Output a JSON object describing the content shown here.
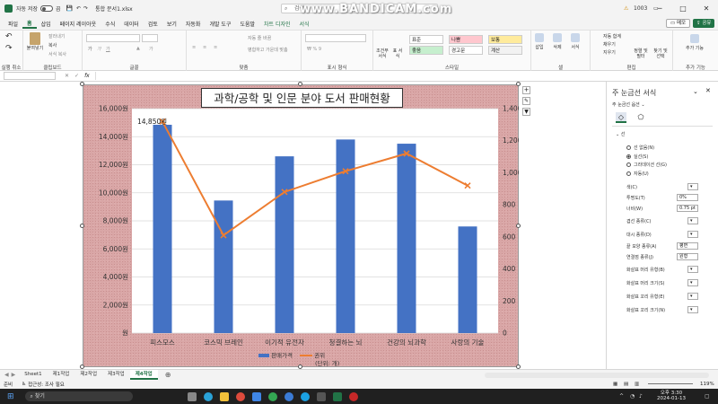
{
  "titlebar": {
    "autosave": "자동 저장",
    "toggle_state": "끔",
    "filename": "통합 문서1.xlsx",
    "search_placeholder": "검색",
    "user_count": "1003"
  },
  "watermark": "www.BANDICAM.com",
  "menu": [
    "파일",
    "홈",
    "삽입",
    "페이지 레이아웃",
    "수식",
    "데이터",
    "검토",
    "보기",
    "자동화",
    "개발 도구",
    "도움말",
    "차트 디자인",
    "서식"
  ],
  "menu_active_index": 1,
  "menu_right": {
    "memo": "메모",
    "share": "공유"
  },
  "ribbon": {
    "groups": [
      "실행 취소",
      "클립보드",
      "글꼴",
      "맞춤",
      "표시 형식",
      "스타일",
      "셀",
      "편집",
      "추가 기능"
    ],
    "paste": "붙여넣기",
    "cut": "잘라내기",
    "copy": "복사",
    "format_painter": "서식 복사",
    "wrap": "자동 줄 바꿈",
    "merge": "병합하고 가운데 맞춤",
    "cond_format": "조건부 서식",
    "table_format": "표 서식",
    "style_normal": "표준",
    "style_bad": "나쁨",
    "style_good": "보통",
    "style_good2": "좋음",
    "style_neutral": "경고문",
    "style_calc": "계산",
    "insert": "삽입",
    "delete": "삭제",
    "format": "서식",
    "autosum": "자동 합계",
    "fill": "채우기",
    "clear": "지우기",
    "sort": "정렬 및 필터",
    "find": "찾기 및 선택",
    "addins": "추가 기능"
  },
  "formula": {
    "fx": "fx",
    "value": ""
  },
  "chart_data": {
    "type": "bar",
    "title": "과학/공학 및 인문 분야 도서 판매현황",
    "categories": [
      "피스모스",
      "코스믹 브레인",
      "이기적 유전자",
      "청결하는 뇌",
      "건강의 뇌과학",
      "사랑의 기술"
    ],
    "series": [
      {
        "name": "판매가격",
        "type": "bar",
        "color": "#4472C4",
        "values": [
          14850,
          9450,
          12600,
          13800,
          13500,
          7600
        ]
      },
      {
        "name": "권위",
        "type": "line",
        "color": "#ED7D31",
        "axis": "secondary",
        "values": [
          1320,
          610,
          880,
          1010,
          1120,
          920
        ]
      }
    ],
    "y_ticks": [
      "원",
      "2,000원",
      "4,000원",
      "6,000원",
      "8,000원",
      "10,000원",
      "12,000원",
      "14,000원",
      "16,000원"
    ],
    "y2_ticks": [
      "0",
      "200",
      "400",
      "600",
      "800",
      "1,000",
      "1,200",
      "1,400"
    ],
    "ylim": [
      0,
      16000
    ],
    "y2lim": [
      0,
      1400
    ],
    "data_label": "14,850원",
    "legend_note": "(단위: 개)",
    "legend_position": "bottom",
    "grid": true
  },
  "pane": {
    "title": "주 눈금선 서식",
    "subtitle": "주 눈금선 옵션",
    "section": "선",
    "options": [
      "선 없음(N)",
      "실선(S)",
      "그라데이션 선(G)",
      "자동(U)"
    ],
    "selected_option": 1,
    "props": [
      {
        "label": "색(C)",
        "value": ""
      },
      {
        "label": "투명도(T)",
        "value": "0%"
      },
      {
        "label": "너비(W)",
        "value": "0.75 pt"
      },
      {
        "label": "겹선 종류(C)",
        "value": ""
      },
      {
        "label": "대시 종류(D)",
        "value": ""
      },
      {
        "label": "끝 모양 종류(A)",
        "value": "평면"
      },
      {
        "label": "연결점 종류(J)",
        "value": "원형"
      },
      {
        "label": "화살표 머리 유형(B)",
        "value": ""
      },
      {
        "label": "화살표 머리 크기(S)",
        "value": ""
      },
      {
        "label": "화살표 꼬리 유형(E)",
        "value": ""
      },
      {
        "label": "화살표 꼬리 크기(N)",
        "value": ""
      }
    ]
  },
  "sheets": [
    "Sheet1",
    "제1작업",
    "제2작업",
    "제3작업",
    "제4작업"
  ],
  "active_sheet_index": 4,
  "status": {
    "ready": "준비",
    "accessibility": "접근성: 조사 필요",
    "zoom": "119%"
  },
  "taskbar": {
    "search": "찾기",
    "time": "오후 3:30",
    "date": "2024-01-13"
  }
}
